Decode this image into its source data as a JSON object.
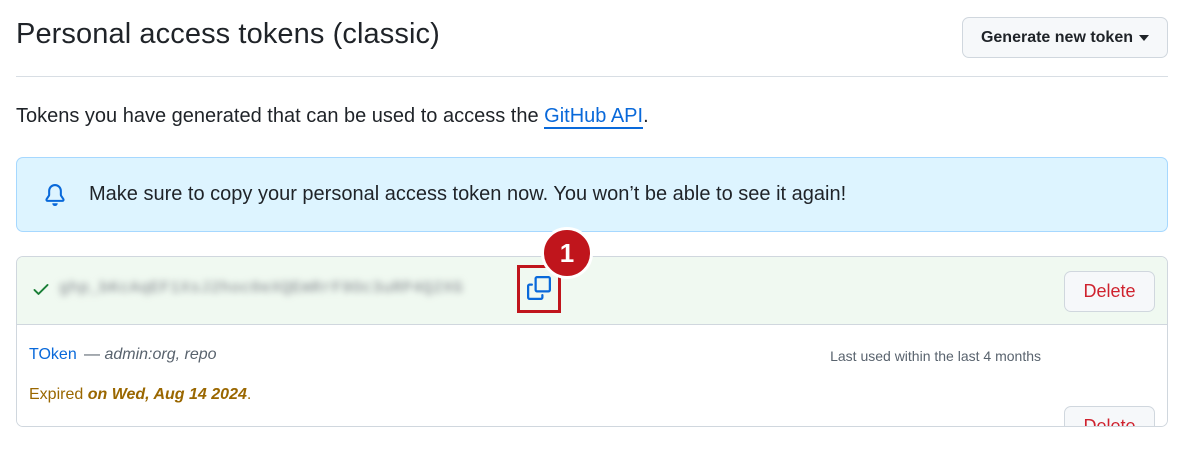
{
  "header": {
    "title": "Personal access tokens (classic)",
    "generate_label": "Generate new token"
  },
  "description": {
    "text": "Tokens you have generated that can be used to access the ",
    "link": "GitHub API",
    "suffix": "."
  },
  "flash": {
    "message": "Make sure to copy your personal access token now. You won’t be able to see it again!"
  },
  "new_token": {
    "value": "ghp_bKcAqEF1XsJ2hoc0eXQEmRrF9Oc3uRP4Q2XG",
    "badge": "1",
    "delete_label": "Delete"
  },
  "token": {
    "name": "TOken",
    "separator": "—",
    "scopes": "admin:org, repo",
    "last_used": "Last used within the last 4 months",
    "expired_prefix": "Expired",
    "expired_date": "on Wed, Aug 14 2024",
    "expired_suffix": ".",
    "delete_label": "Delete"
  },
  "colors": {
    "link": "#0969da",
    "danger": "#cf222e",
    "success": "#1a7f37",
    "warning": "#9a6700",
    "annotation": "#c0151c"
  },
  "icons": [
    "caret-down-icon",
    "bell-icon",
    "check-icon",
    "copy-icon"
  ]
}
